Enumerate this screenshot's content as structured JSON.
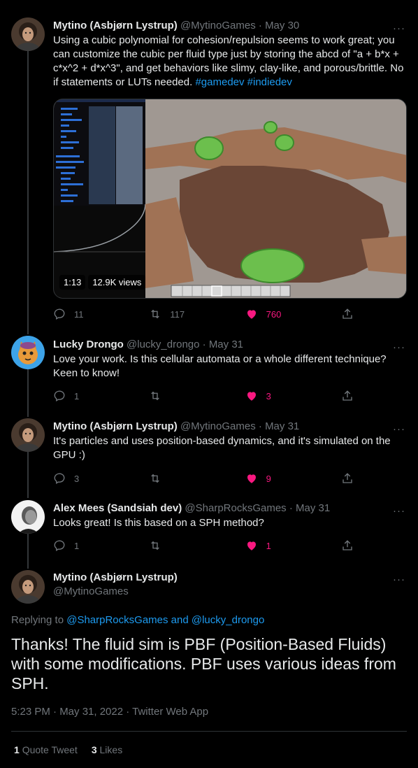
{
  "colors": {
    "background": "#000000",
    "link": "#1d9bf0",
    "like": "#f91880",
    "muted": "#71767b"
  },
  "tweets": [
    {
      "name": "Mytino (Asbjørn Lystrup)",
      "handle": "@MytinoGames",
      "date": "May 30",
      "text": "Using a cubic polynomial for cohesion/repulsion seems to work great; you can customize the cubic per fluid type just by storing the abcd of \"a + b*x + c*x^2 + d*x^3\", and get behaviors like slimy, clay-like, and porous/brittle. No if statements or LUTs needed.",
      "hashtags": "#gamedev #indiedev",
      "video_time": "1:13",
      "video_views": "12.9K views",
      "replies": "11",
      "retweets": "117",
      "likes": "760"
    },
    {
      "name": "Lucky Drongo",
      "handle": "@lucky_drongo",
      "date": "May 31",
      "text": "Love your work. Is this cellular automata or a whole different technique? Keen to know!",
      "replies": "1",
      "retweets": "",
      "likes": "3"
    },
    {
      "name": "Mytino (Asbjørn Lystrup)",
      "handle": "@MytinoGames",
      "date": "May 31",
      "text": "It's particles and uses position-based dynamics, and it's simulated on the GPU :)",
      "replies": "3",
      "retweets": "",
      "likes": "9"
    },
    {
      "name": "Alex Mees (Sandsiah dev)",
      "handle": "@SharpRocksGames",
      "date": "May 31",
      "text": "Looks great! Is this based on a SPH method?",
      "replies": "1",
      "retweets": "",
      "likes": "1"
    }
  ],
  "focused": {
    "name": "Mytino (Asbjørn Lystrup)",
    "handle": "@MytinoGames",
    "replying_label": "Replying to",
    "replying_to": "@SharpRocksGames and @lucky_drongo",
    "text": "Thanks! The fluid sim is PBF (Position-Based Fluids) with some modifications. PBF uses various ideas from SPH.",
    "timestamp": "5:23 PM · May 31, 2022 · Twitter Web App",
    "quote_count": "1",
    "quote_label": "Quote Tweet",
    "like_count": "3",
    "like_label": "Likes"
  },
  "sep": "·",
  "more": "···"
}
